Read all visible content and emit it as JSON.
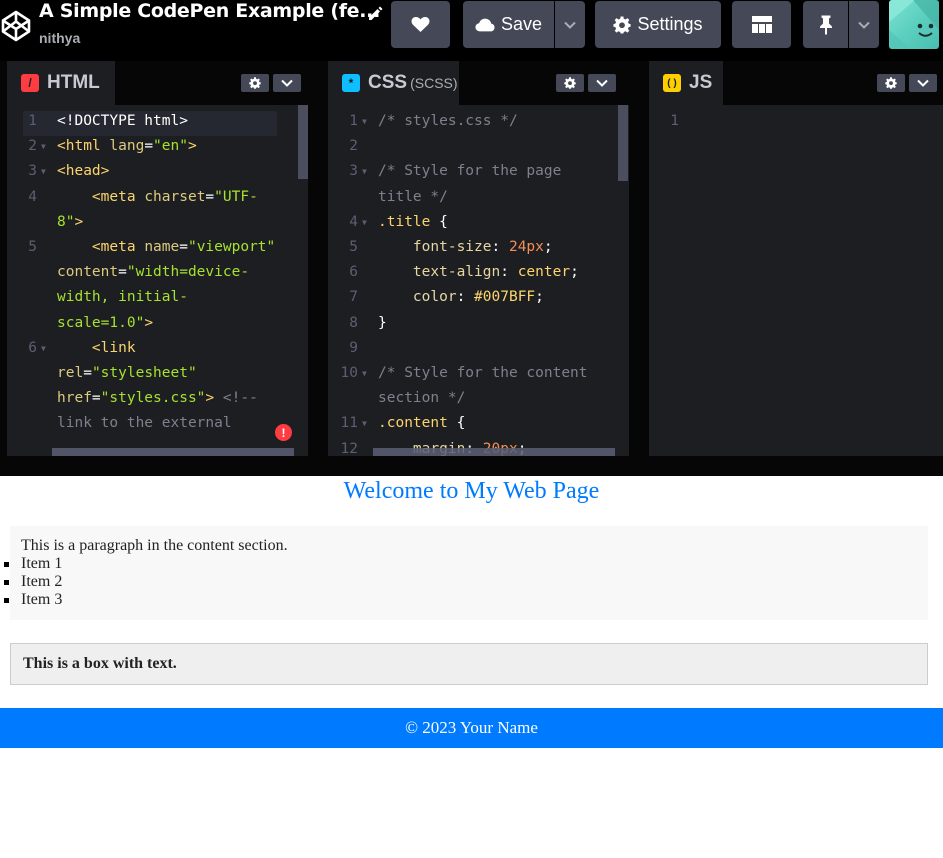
{
  "header": {
    "title": "A Simple CodePen Example (fe...",
    "owner": "nithya",
    "save_label": "Save",
    "settings_label": "Settings"
  },
  "editors": {
    "html": {
      "label": "HTML",
      "icon_glyph": "/",
      "icon_color": "#ff3c41",
      "lines": [
        {
          "n": "1",
          "fold": false,
          "parts": [
            [
              "t-plain",
              "<!DOCTYPE html>"
            ]
          ]
        },
        {
          "n": "2",
          "fold": true,
          "parts": [
            [
              "t-tag",
              "<html "
            ],
            [
              "t-attr",
              "lang"
            ],
            [
              "t-plain",
              "="
            ],
            [
              "t-str",
              "\"en\""
            ],
            [
              "t-tag",
              ">"
            ]
          ]
        },
        {
          "n": "3",
          "fold": true,
          "parts": [
            [
              "t-tag",
              "<head>"
            ]
          ]
        },
        {
          "n": "4",
          "fold": false,
          "parts": [
            [
              "t-tag",
              "    <meta "
            ],
            [
              "t-attr",
              "charset"
            ],
            [
              "t-plain",
              "="
            ],
            [
              "t-str",
              "\"UTF-8\""
            ],
            [
              "t-tag",
              ">"
            ]
          ]
        },
        {
          "n": "5",
          "fold": false,
          "parts": [
            [
              "t-tag",
              "    <meta "
            ],
            [
              "t-attr",
              "name"
            ],
            [
              "t-plain",
              "="
            ],
            [
              "t-str",
              "\"viewport\" "
            ],
            [
              "t-attr",
              "content"
            ],
            [
              "t-plain",
              "="
            ],
            [
              "t-str",
              "\"width=device-width, initial-scale=1.0\""
            ],
            [
              "t-tag",
              ">"
            ]
          ]
        },
        {
          "n": "6",
          "fold": true,
          "parts": [
            [
              "t-tag",
              "    <link "
            ],
            [
              "t-attr",
              "rel"
            ],
            [
              "t-plain",
              "="
            ],
            [
              "t-str",
              "\"stylesheet\" "
            ],
            [
              "t-attr",
              "href"
            ],
            [
              "t-plain",
              "="
            ],
            [
              "t-str",
              "\"styles.css\""
            ],
            [
              "t-tag",
              "> "
            ],
            [
              "t-dim",
              "<!-- link to the external"
            ]
          ]
        }
      ]
    },
    "css": {
      "label": "CSS",
      "sublabel": "(SCSS)",
      "icon_glyph": "*",
      "icon_color": "#0ebeff",
      "lines": [
        {
          "n": "1",
          "fold": true,
          "parts": [
            [
              "t-dim",
              "/* styles.css */"
            ]
          ]
        },
        {
          "n": "2",
          "fold": false,
          "parts": [
            [
              "t-plain",
              " "
            ]
          ]
        },
        {
          "n": "3",
          "fold": true,
          "parts": [
            [
              "t-dim",
              "/* Style for the page title */"
            ]
          ]
        },
        {
          "n": "4",
          "fold": true,
          "parts": [
            [
              "t-sel",
              ".title "
            ],
            [
              "t-plain",
              "{"
            ]
          ]
        },
        {
          "n": "5",
          "fold": false,
          "parts": [
            [
              "t-prop",
              "    font-size"
            ],
            [
              "t-plain",
              ": "
            ],
            [
              "t-num",
              "24px"
            ],
            [
              "t-plain",
              ";"
            ]
          ]
        },
        {
          "n": "6",
          "fold": false,
          "parts": [
            [
              "t-prop",
              "    text-align"
            ],
            [
              "t-plain",
              ": "
            ],
            [
              "t-sel",
              "center"
            ],
            [
              "t-plain",
              ";"
            ]
          ]
        },
        {
          "n": "7",
          "fold": false,
          "parts": [
            [
              "t-prop",
              "    color"
            ],
            [
              "t-plain",
              ": "
            ],
            [
              "t-sel",
              "#007BFF"
            ],
            [
              "t-plain",
              ";"
            ]
          ]
        },
        {
          "n": "8",
          "fold": false,
          "parts": [
            [
              "t-plain",
              "}"
            ]
          ]
        },
        {
          "n": "9",
          "fold": false,
          "parts": [
            [
              "t-plain",
              " "
            ]
          ]
        },
        {
          "n": "10",
          "fold": true,
          "parts": [
            [
              "t-dim",
              "/* Style for the content section */"
            ]
          ]
        },
        {
          "n": "11",
          "fold": true,
          "parts": [
            [
              "t-sel",
              ".content "
            ],
            [
              "t-plain",
              "{"
            ]
          ]
        },
        {
          "n": "12",
          "fold": false,
          "parts": [
            [
              "t-prop",
              "    margin"
            ],
            [
              "t-plain",
              ": "
            ],
            [
              "t-num",
              "20px"
            ],
            [
              "t-plain",
              ";"
            ]
          ]
        }
      ]
    },
    "js": {
      "label": "JS",
      "icon_glyph": "( )",
      "icon_color": "#fcd000",
      "lines": [
        {
          "n": "1",
          "fold": false,
          "parts": [
            [
              "t-plain",
              " "
            ]
          ]
        }
      ]
    }
  },
  "preview": {
    "title": "Welcome to My Web Page",
    "paragraph": "This is a paragraph in the content section.",
    "items": [
      "Item 1",
      "Item 2",
      "Item 3"
    ],
    "box_text": "This is a box with text.",
    "footer": "© 2023 Your Name"
  },
  "colors": {
    "accent": "#007bff",
    "error": "#ff3c41",
    "button_bg": "#444857"
  }
}
